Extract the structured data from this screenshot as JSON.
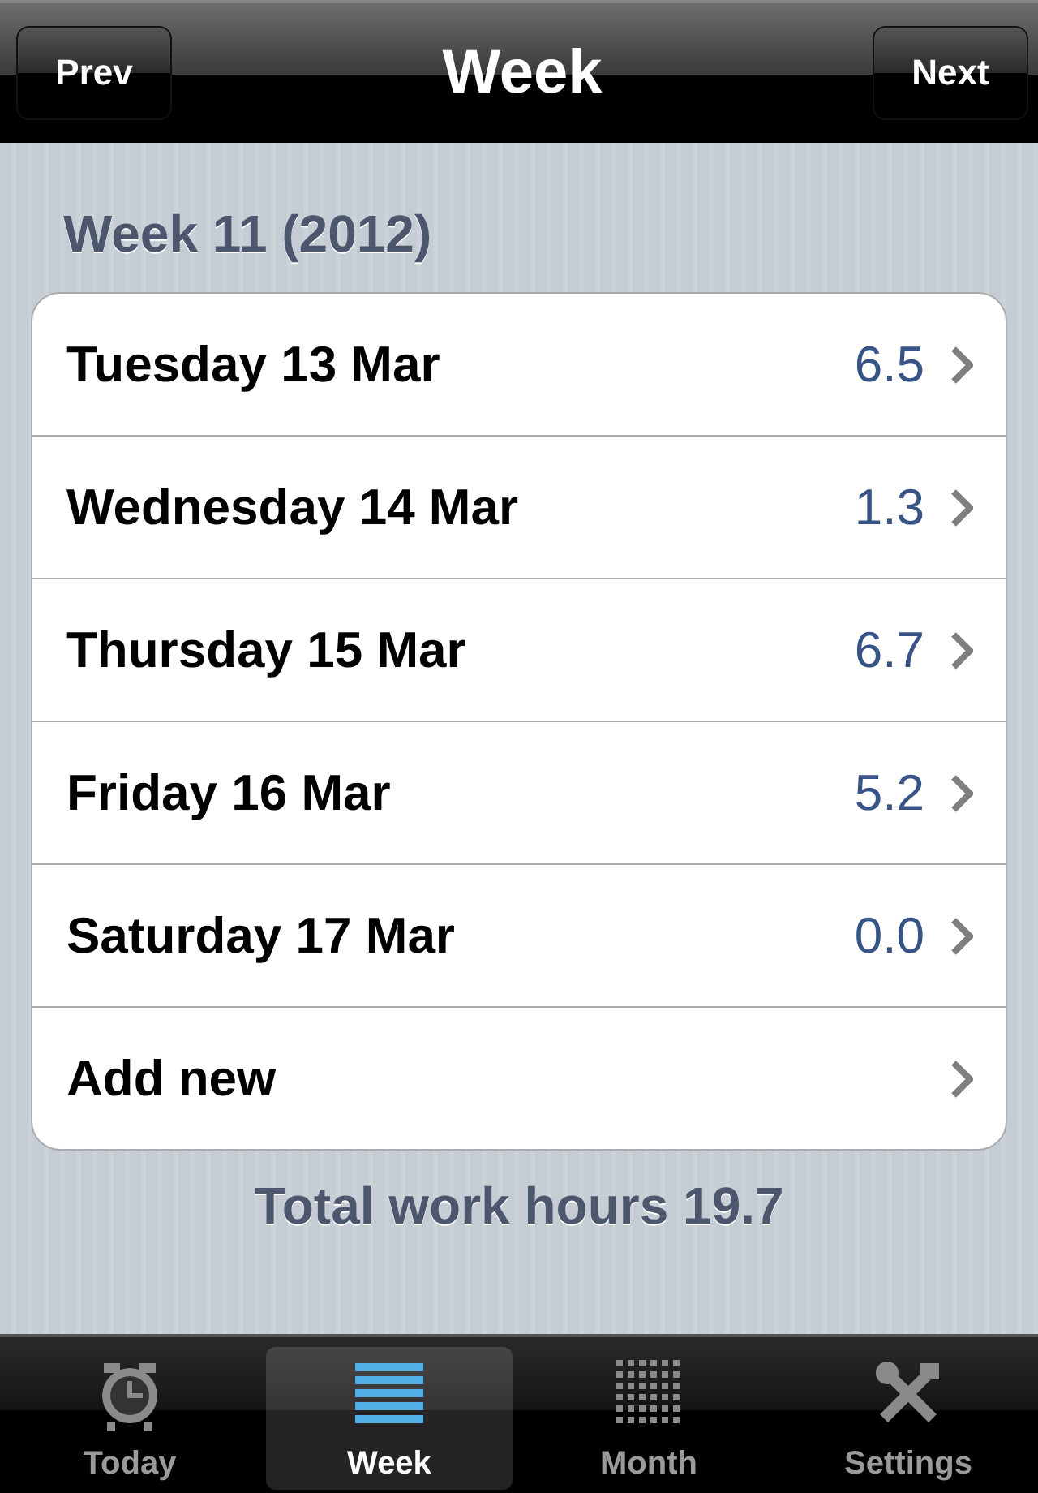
{
  "nav_bar": {
    "title": "Week",
    "left_button": "Prev",
    "right_button": "Next"
  },
  "section_title": "Week 11 (2012)",
  "rows": [
    {
      "label": "Tuesday 13 Mar",
      "value": "6.5"
    },
    {
      "label": "Wednesday 14 Mar",
      "value": "1.3"
    },
    {
      "label": "Thursday 15 Mar",
      "value": "6.7"
    },
    {
      "label": "Friday 16 Mar",
      "value": "5.2"
    },
    {
      "label": "Saturday 17 Mar",
      "value": "0.0"
    },
    {
      "label": "Add new"
    }
  ],
  "total": "Total work hours 19.7",
  "tab_bar": [
    {
      "label": "Today",
      "selected": false
    },
    {
      "label": "Week",
      "selected": true
    },
    {
      "label": "Month",
      "selected": false
    },
    {
      "label": "Settings",
      "selected": false
    }
  ]
}
